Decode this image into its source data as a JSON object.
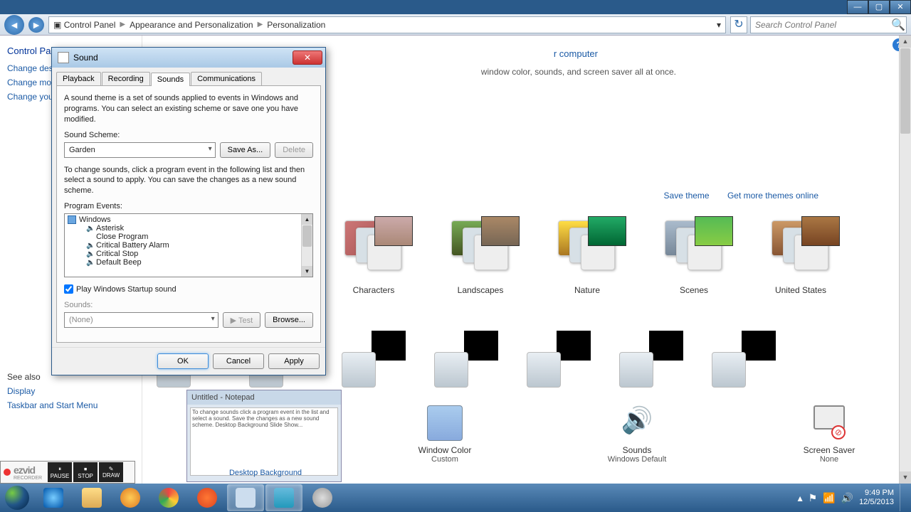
{
  "window_controls": {
    "min": "—",
    "max": "▢",
    "close": "✕"
  },
  "explorer": {
    "breadcrumbs": [
      "Control Panel",
      "Appearance and Personalization",
      "Personalization"
    ],
    "search_placeholder": "Search Control Panel"
  },
  "sidepanel": {
    "header": "Control Panel Home",
    "links": [
      "Change desktop icons",
      "Change mouse pointers",
      "Change your account picture"
    ],
    "seealso_label": "See also",
    "seealso": [
      "Display",
      "Taskbar and Start Menu"
    ]
  },
  "content": {
    "title_partial": "r computer",
    "subtitle_partial": "window color, sounds, and screen saver all at once.",
    "save_theme": "Save theme",
    "get_more": "Get more themes online",
    "aero_themes": [
      "Characters",
      "Landscapes",
      "Nature",
      "Scenes",
      "United States"
    ],
    "bottom": {
      "wc": {
        "label": "Window Color",
        "sub": "Custom"
      },
      "snd": {
        "label": "Sounds",
        "sub": "Windows Default"
      },
      "ss": {
        "label": "Screen Saver",
        "sub": "None"
      }
    },
    "hidden_label": "Desktop Background"
  },
  "help": "?",
  "sound_dialog": {
    "title": "Sound",
    "tabs": [
      "Playback",
      "Recording",
      "Sounds",
      "Communications"
    ],
    "active_tab": "Sounds",
    "desc": "A sound theme is a set of sounds applied to events in Windows and programs. You can select an existing scheme or save one you have modified.",
    "scheme_label": "Sound Scheme:",
    "scheme_value": "Garden",
    "save_as": "Save As...",
    "delete": "Delete",
    "change_desc": "To change sounds, click a program event in the following list and then select a sound to apply. You can save the changes as a new sound scheme.",
    "events_label": "Program Events:",
    "tree_root": "Windows",
    "events": [
      "Asterisk",
      "Close Program",
      "Critical Battery Alarm",
      "Critical Stop",
      "Default Beep"
    ],
    "play_startup": "Play Windows Startup sound",
    "sounds_label": "Sounds:",
    "sounds_value": "(None)",
    "test": "Test",
    "browse": "Browse...",
    "ok": "OK",
    "cancel": "Cancel",
    "apply": "Apply"
  },
  "notepad": {
    "title": "Untitled - Notepad",
    "overlay": "Desktop Background"
  },
  "ezvid": {
    "name": "ezvid",
    "sub": "RECORDER",
    "pause": "PAUSE",
    "stop": "STOP",
    "draw": "DRAW"
  },
  "tray": {
    "time": "9:49 PM",
    "date": "12/5/2013"
  }
}
